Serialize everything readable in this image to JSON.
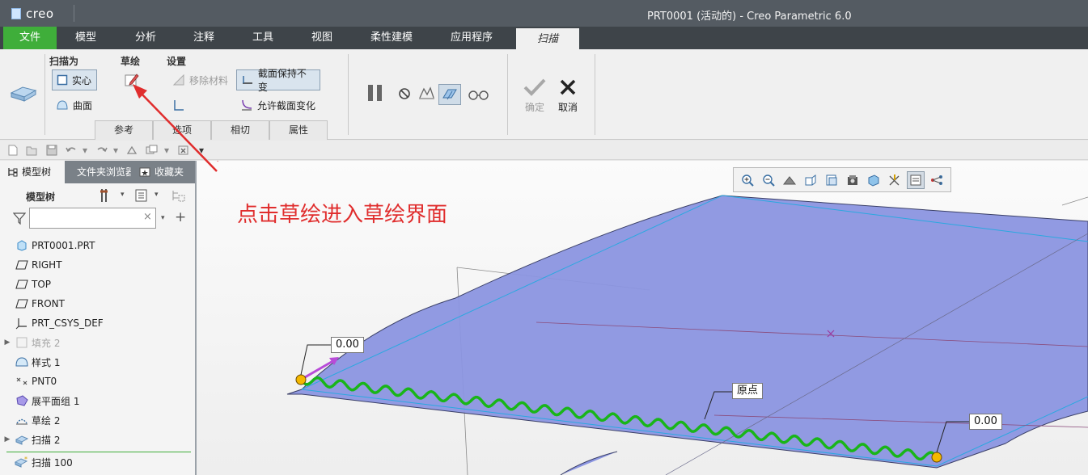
{
  "window": {
    "logo": "creo",
    "title": "PRT0001 (活动的) - Creo Parametric 6.0"
  },
  "menu": {
    "tabs": [
      "文件",
      "模型",
      "分析",
      "注释",
      "工具",
      "视图",
      "柔性建模",
      "应用程序",
      "扫描"
    ]
  },
  "ribbon": {
    "groups": {
      "sweep_as": "扫描为",
      "sketch": "草绘",
      "settings": "设置"
    },
    "buttons": {
      "solid": "实心",
      "surface": "曲面",
      "remove_material": "移除材料",
      "constant_section": "截面保持不变",
      "variable_section": "允许截面变化",
      "ok": "确定",
      "cancel": "取消"
    },
    "sub_tabs": [
      "参考",
      "选项",
      "相切",
      "属性"
    ]
  },
  "left_panel": {
    "tabs": [
      "模型树",
      "文件夹浏览器",
      "收藏夹"
    ],
    "header": "模型树",
    "search_placeholder": "",
    "tree": [
      {
        "label": "PRT0001.PRT",
        "icon": "part-icon",
        "expandable": false,
        "dim": false
      },
      {
        "label": "RIGHT",
        "icon": "datum-plane-icon",
        "expandable": false,
        "dim": false
      },
      {
        "label": "TOP",
        "icon": "datum-plane-icon",
        "expandable": false,
        "dim": false
      },
      {
        "label": "FRONT",
        "icon": "datum-plane-icon",
        "expandable": false,
        "dim": false
      },
      {
        "label": "PRT_CSYS_DEF",
        "icon": "csys-icon",
        "expandable": false,
        "dim": false
      },
      {
        "label": "填充 2",
        "icon": "fill-icon",
        "expandable": true,
        "dim": true
      },
      {
        "label": "样式 1",
        "icon": "style-icon",
        "expandable": false,
        "dim": false
      },
      {
        "label": "PNT0",
        "icon": "datum-point-icon",
        "expandable": false,
        "dim": false
      },
      {
        "label": "展平面组 1",
        "icon": "flatten-quilt-icon",
        "expandable": false,
        "dim": false
      },
      {
        "label": "草绘 2",
        "icon": "sketch-icon",
        "expandable": false,
        "dim": false
      },
      {
        "label": "扫描 2",
        "icon": "sweep-icon",
        "expandable": true,
        "dim": false
      },
      {
        "label": "扫描 100",
        "icon": "sweep-new-icon",
        "expandable": false,
        "dim": false
      }
    ]
  },
  "viewport": {
    "annotation": "点击草绘进入草绘界面",
    "dim_start": "0.00",
    "dim_end": "0.00",
    "origin_label": "原点"
  },
  "colors": {
    "file_tab": "#3fae3a",
    "surface_fill": "#8b95e0",
    "trajectory": "#19b519",
    "annotation": "#e02d2d",
    "handle": "#f5b800"
  }
}
